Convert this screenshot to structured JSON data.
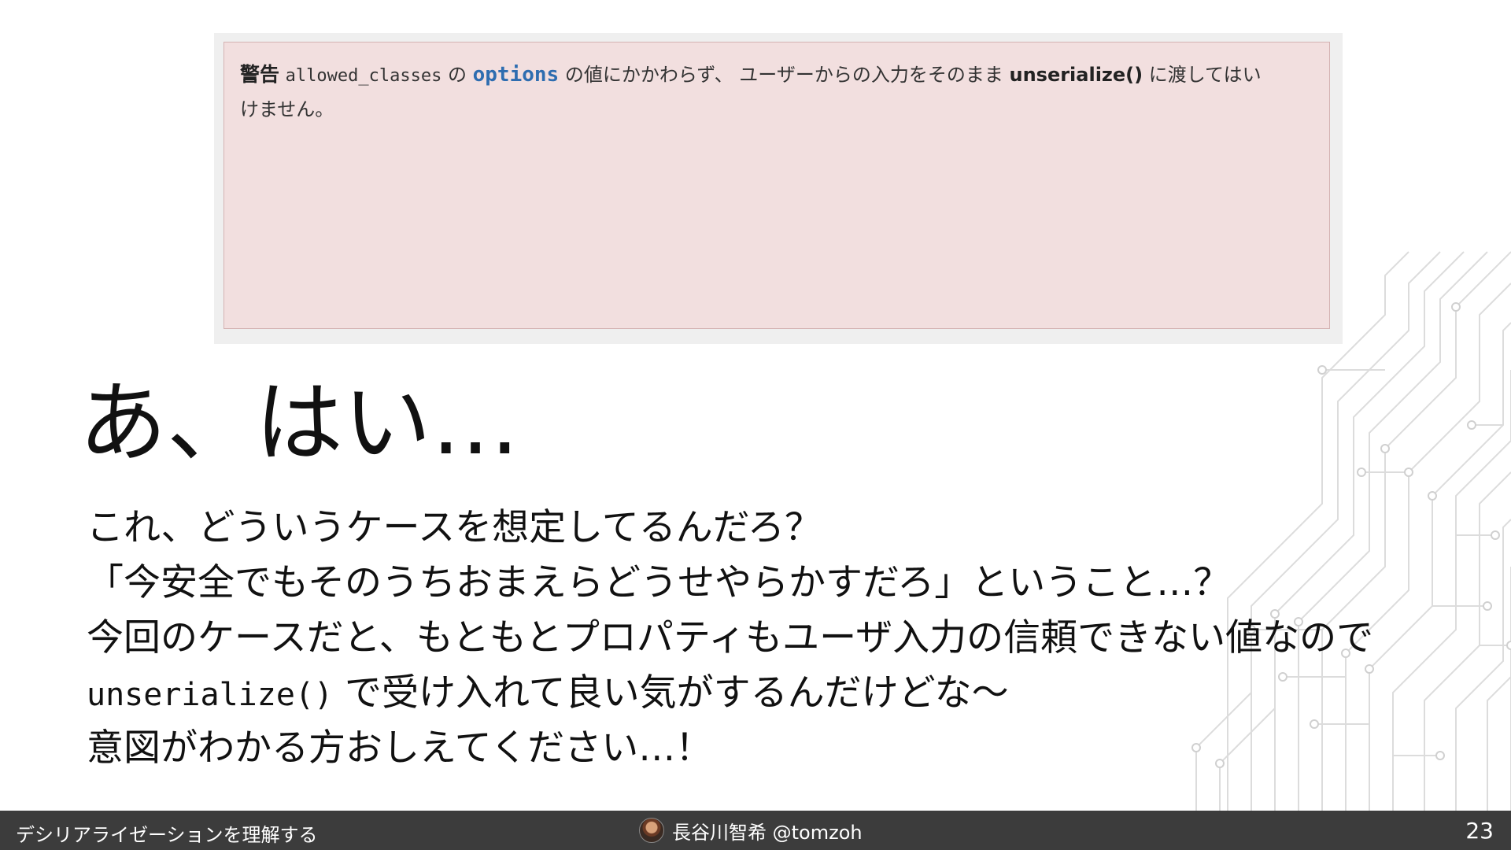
{
  "warning": {
    "label": "警告",
    "code_option": "allowed_classes",
    "text_no": "の",
    "keyword": "options",
    "text_mid": "の値にかかわらず、 ユーザーからの入力をそのまま",
    "function": "unserialize()",
    "text_end": "に渡してはい",
    "text_wrap": "けません。"
  },
  "headline": "あ、はい…",
  "body": {
    "line1": "これ、どういうケースを想定してるんだろ？",
    "line2": "「今安全でもそのうちおまえらどうせやらかすだろ」ということ…？",
    "line3": "今回のケースだと、もともとプロパティもユーザ入力の信頼できない値なので",
    "line4_code": "unserialize()",
    "line4_text": "で受け入れて良い気がするんだけどな〜",
    "line5": "意図がわかる方おしえてください…！"
  },
  "footer": {
    "title": "デシリアライゼーションを理解する",
    "author": "長谷川智希 @tomzoh",
    "page": "23"
  },
  "colors": {
    "warning_bg": "#f2dfdf",
    "warning_border": "#d4b2b2",
    "keyword": "#2e6db0",
    "footer_bg": "#3c3c3c"
  }
}
